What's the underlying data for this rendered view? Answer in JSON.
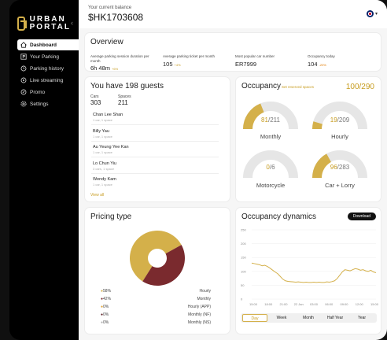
{
  "brand": {
    "line1": "URBAN",
    "line2": "PORTAL"
  },
  "sidebar": {
    "items": [
      {
        "label": "Dashboard",
        "icon": "home-icon",
        "active": true
      },
      {
        "label": "Your Parking",
        "icon": "parking-icon"
      },
      {
        "label": "Parking history",
        "icon": "history-icon"
      },
      {
        "label": "Live streaming",
        "icon": "play-icon"
      },
      {
        "label": "Promo",
        "icon": "promo-icon"
      },
      {
        "label": "Settings",
        "icon": "gear-icon"
      }
    ]
  },
  "header": {
    "balance_label": "Your current balance",
    "balance_value": "$HK1703608",
    "language_icon": "uk-flag-icon"
  },
  "overview": {
    "title": "Overview",
    "stats": [
      {
        "label": "Average parking session duration per month",
        "value": "6h 48m",
        "delta": "+6%",
        "trend": "up"
      },
      {
        "label": "Average parking ticket per month",
        "value": "105",
        "delta": "+4%",
        "trend": "up"
      },
      {
        "label": "Most popular car number",
        "value": "ER7999",
        "delta": "",
        "trend": ""
      },
      {
        "label": "Occupancy today",
        "value": "104",
        "delta": "-20%",
        "trend": "down"
      }
    ]
  },
  "guests": {
    "title": "You have 198 guests",
    "cars_label": "Cars",
    "cars_value": "303",
    "spaces_label": "Spaces",
    "spaces_value": "211",
    "list": [
      {
        "name": "Chan Lee Shan",
        "sub": "1 car, 1 space"
      },
      {
        "name": "Billy Yau",
        "sub": "1 car, 1 space"
      },
      {
        "name": "Au Yeung Yee Kan",
        "sub": "1 car, 1 space"
      },
      {
        "name": "Lo Chun Yiu",
        "sub": "3 cars, 1 space"
      },
      {
        "name": "Wendy Kam",
        "sub": "1 car, 1 space"
      }
    ],
    "view_all": "View all"
  },
  "occupancy": {
    "title": "Occupancy",
    "link": "Set reserved spaces",
    "total": "100/290",
    "gauges": [
      {
        "label": "Monthly",
        "used": "81",
        "cap": "211",
        "fraction": 0.38
      },
      {
        "label": "Hourly",
        "used": "19",
        "cap": "209",
        "fraction": 0.09
      },
      {
        "label": "Motorcycle",
        "used": "0",
        "cap": "6",
        "fraction": 0.0
      },
      {
        "label": "Car + Lorry",
        "used": "96",
        "cap": "283",
        "fraction": 0.34
      }
    ]
  },
  "colors": {
    "gold": "#d4b04a",
    "maroon": "#7a2a2e",
    "gauge_bg": "#e6e6e6"
  },
  "pricing": {
    "title": "Pricing type",
    "chart_data": {
      "type": "pie",
      "categories": [
        "Hourly",
        "Monthly",
        "Hourly (APP)",
        "Monthly (NF)",
        "Monthly (NS)"
      ],
      "values": [
        58,
        42,
        0,
        0,
        0
      ],
      "labels": [
        "58%",
        "42%",
        "0%",
        "0%",
        "0%"
      ],
      "colors": [
        "#d4b04a",
        "#7a2a2e",
        "#e0a030",
        "#5a1a20",
        "#b0b0b0"
      ]
    }
  },
  "dynamics": {
    "title": "Occupancy dynamics",
    "download": "Download",
    "periods": [
      "Day",
      "Week",
      "Month",
      "Half Year",
      "Year"
    ],
    "active_period": "Day",
    "chart_data": {
      "type": "line",
      "yticks": [
        "250",
        "200",
        "150",
        "100",
        "50",
        "0"
      ],
      "ylim": [
        0,
        250
      ],
      "xticks": [
        "15:00",
        "18:00",
        "21:00",
        "22 Jan",
        "03:00",
        "06:00",
        "09:00",
        "12:00",
        "15:00"
      ],
      "x": [
        0,
        0.5,
        1,
        1.5,
        2,
        2.5,
        3,
        3.5,
        4,
        4.5,
        5,
        5.5,
        6,
        6.5,
        7,
        7.5,
        8,
        8.5,
        9,
        9.5,
        10,
        10.5,
        11,
        11.5,
        12,
        12.5,
        13,
        13.5,
        14,
        14.5,
        15,
        15.5,
        16,
        16.5,
        17,
        17.5,
        18,
        18.5,
        19,
        19.5,
        20,
        20.5,
        21,
        21.5,
        22,
        22.5,
        23,
        23.5,
        24
      ],
      "y": [
        130,
        128,
        126,
        124,
        120,
        122,
        118,
        112,
        105,
        98,
        92,
        82,
        72,
        66,
        64,
        63,
        62,
        61,
        62,
        61,
        60,
        61,
        60,
        60,
        61,
        60,
        61,
        60,
        60,
        62,
        61,
        63,
        66,
        74,
        86,
        98,
        106,
        104,
        102,
        106,
        110,
        108,
        104,
        106,
        102,
        100,
        104,
        98,
        95
      ]
    }
  }
}
